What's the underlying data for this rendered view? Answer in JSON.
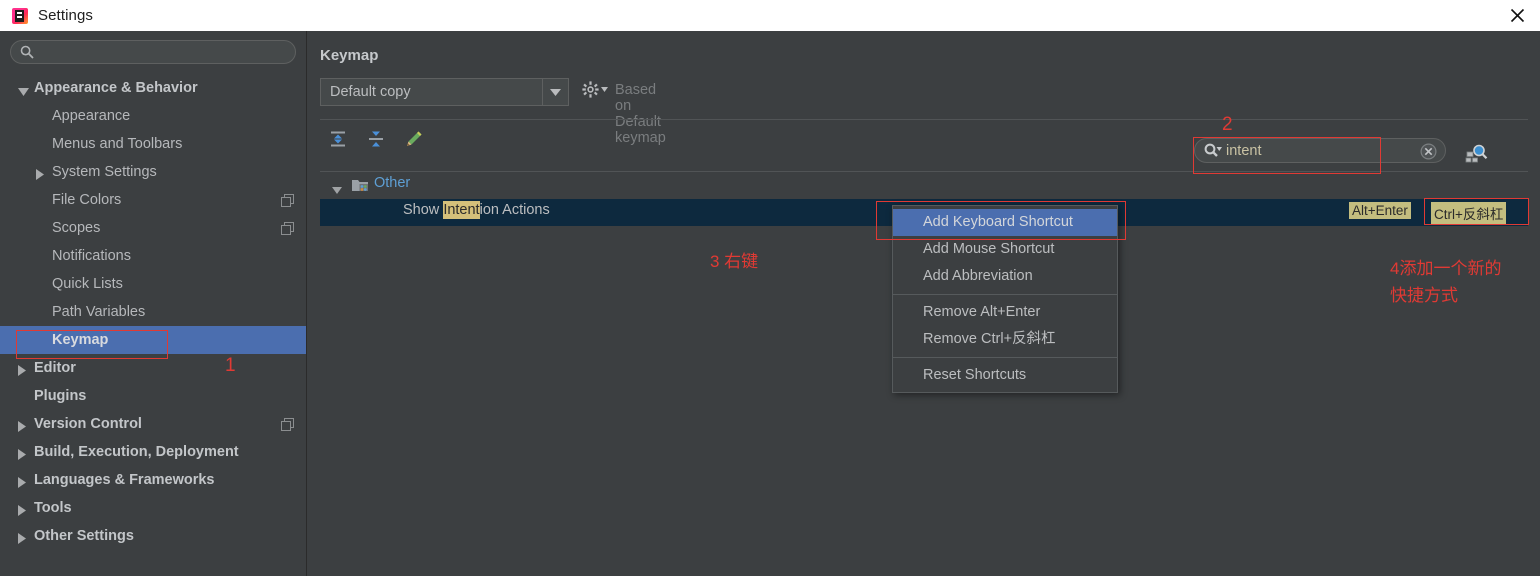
{
  "window": {
    "title": "Settings",
    "app_icon": "intellij-idea-icon",
    "close_icon": "close-icon"
  },
  "sidebar": {
    "search": {
      "value": "",
      "placeholder": "",
      "icon": "search-icon"
    },
    "items": [
      {
        "label": "Appearance & Behavior",
        "level": 0,
        "expander": "down",
        "bold": true,
        "copy": false,
        "selected": false
      },
      {
        "label": "Appearance",
        "level": 1,
        "expander": "none",
        "bold": false,
        "copy": false,
        "selected": false
      },
      {
        "label": "Menus and Toolbars",
        "level": 1,
        "expander": "none",
        "bold": false,
        "copy": false,
        "selected": false
      },
      {
        "label": "System Settings",
        "level": 1,
        "expander": "right",
        "bold": false,
        "copy": false,
        "selected": false
      },
      {
        "label": "File Colors",
        "level": 1,
        "expander": "none",
        "bold": false,
        "copy": true,
        "selected": false
      },
      {
        "label": "Scopes",
        "level": 1,
        "expander": "none",
        "bold": false,
        "copy": true,
        "selected": false
      },
      {
        "label": "Notifications",
        "level": 1,
        "expander": "none",
        "bold": false,
        "copy": false,
        "selected": false
      },
      {
        "label": "Quick Lists",
        "level": 1,
        "expander": "none",
        "bold": false,
        "copy": false,
        "selected": false
      },
      {
        "label": "Path Variables",
        "level": 1,
        "expander": "none",
        "bold": false,
        "copy": false,
        "selected": false
      },
      {
        "label": "Keymap",
        "level": 1,
        "expander": "none",
        "bold": true,
        "copy": false,
        "selected": true
      },
      {
        "label": "Editor",
        "level": 0,
        "expander": "right",
        "bold": true,
        "copy": false,
        "selected": false
      },
      {
        "label": "Plugins",
        "level": 0,
        "expander": "none",
        "bold": true,
        "copy": false,
        "selected": false
      },
      {
        "label": "Version Control",
        "level": 0,
        "expander": "right",
        "bold": true,
        "copy": true,
        "selected": false
      },
      {
        "label": "Build, Execution, Deployment",
        "level": 0,
        "expander": "right",
        "bold": true,
        "copy": false,
        "selected": false
      },
      {
        "label": "Languages & Frameworks",
        "level": 0,
        "expander": "right",
        "bold": true,
        "copy": false,
        "selected": false
      },
      {
        "label": "Tools",
        "level": 0,
        "expander": "right",
        "bold": true,
        "copy": false,
        "selected": false
      },
      {
        "label": "Other Settings",
        "level": 0,
        "expander": "right",
        "bold": true,
        "copy": false,
        "selected": false
      }
    ]
  },
  "main": {
    "panel_title": "Keymap",
    "keymap_select": {
      "value": "Default copy",
      "dropdown_icon": "chevron-down-icon"
    },
    "gear_label": "gear-icon",
    "based_on": "Based on Default keymap",
    "toolbar": [
      {
        "name": "expand-all-icon",
        "tooltip": "Expand All"
      },
      {
        "name": "collapse-all-icon",
        "tooltip": "Collapse All"
      },
      {
        "name": "edit-pencil-icon",
        "tooltip": "Edit Shortcut"
      }
    ],
    "action_search": {
      "value": "intent",
      "placeholder": "",
      "icon": "search-filter-icon",
      "clear_icon": "clear-circle-icon"
    },
    "find_by_shortcut_icon": "find-by-shortcut-icon",
    "tree": {
      "group": {
        "label": "Other",
        "expander": "down",
        "icon": "folder-icon"
      },
      "action": {
        "prefix": "Show ",
        "highlight": "Intent",
        "suffix": "ion Actions",
        "shortcuts": [
          "Alt+Enter",
          "Ctrl+反斜杠"
        ]
      }
    }
  },
  "context_menu": {
    "items": [
      {
        "label": "Add Keyboard Shortcut",
        "highlighted": true,
        "separator_after": false
      },
      {
        "label": "Add Mouse Shortcut",
        "highlighted": false,
        "separator_after": false
      },
      {
        "label": "Add Abbreviation",
        "highlighted": false,
        "separator_after": true
      },
      {
        "label": "Remove Alt+Enter",
        "highlighted": false,
        "separator_after": false
      },
      {
        "label": "Remove Ctrl+反斜杠",
        "highlighted": false,
        "separator_after": true
      },
      {
        "label": "Reset Shortcuts",
        "highlighted": false,
        "separator_after": false
      }
    ]
  },
  "annotations": {
    "color": "#e03a34",
    "marker_1": "1",
    "marker_2": "2",
    "marker_3": "3  右键",
    "marker_4_line1": "4添加一个新的",
    "marker_4_line2": "快捷方式"
  },
  "colors": {
    "window_bg": "#3c3f41",
    "titlebar_bg": "#ffffff",
    "selection_blue": "#4b6eaf",
    "row_selected_dark": "#0d293e",
    "link_blue": "#5e9fd4",
    "shortcut_badge": "#c3bd7f",
    "annotation_red": "#e03a34"
  }
}
